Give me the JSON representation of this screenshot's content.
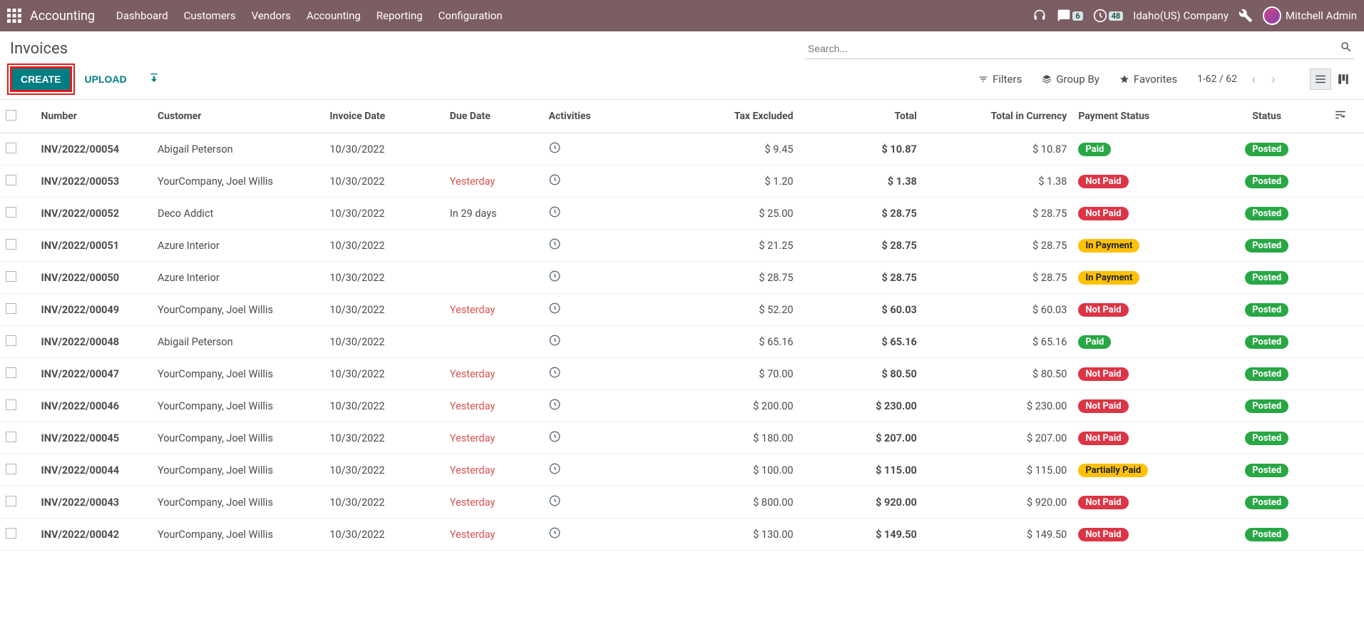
{
  "topbar": {
    "app_title": "Accounting",
    "nav": [
      "Dashboard",
      "Customers",
      "Vendors",
      "Accounting",
      "Reporting",
      "Configuration"
    ],
    "chat_badge": "6",
    "activity_badge": "48",
    "company": "Idaho(US) Company",
    "user": "Mitchell Admin"
  },
  "page": {
    "title": "Invoices",
    "create": "CREATE",
    "upload": "UPLOAD",
    "search_placeholder": "Search...",
    "filters": "Filters",
    "group_by": "Group By",
    "favorites": "Favorites",
    "pager": "1-62 / 62"
  },
  "columns": {
    "number": "Number",
    "customer": "Customer",
    "invoice_date": "Invoice Date",
    "due_date": "Due Date",
    "activities": "Activities",
    "tax_excluded": "Tax Excluded",
    "total": "Total",
    "total_currency": "Total in Currency",
    "payment_status": "Payment Status",
    "status": "Status"
  },
  "rows": [
    {
      "number": "INV/2022/00054",
      "customer": "Abigail Peterson",
      "invoice_date": "10/30/2022",
      "due_date": "",
      "due_red": false,
      "tax": "$ 9.45",
      "total": "$ 10.87",
      "currency": "$ 10.87",
      "pay": "Paid",
      "pay_cls": "pay-paid",
      "status": "Posted"
    },
    {
      "number": "INV/2022/00053",
      "customer": "YourCompany, Joel Willis",
      "invoice_date": "10/30/2022",
      "due_date": "Yesterday",
      "due_red": true,
      "tax": "$ 1.20",
      "total": "$ 1.38",
      "currency": "$ 1.38",
      "pay": "Not Paid",
      "pay_cls": "pay-notpaid",
      "status": "Posted"
    },
    {
      "number": "INV/2022/00052",
      "customer": "Deco Addict",
      "invoice_date": "10/30/2022",
      "due_date": "In 29 days",
      "due_red": false,
      "tax": "$ 25.00",
      "total": "$ 28.75",
      "currency": "$ 28.75",
      "pay": "Not Paid",
      "pay_cls": "pay-notpaid",
      "status": "Posted"
    },
    {
      "number": "INV/2022/00051",
      "customer": "Azure Interior",
      "invoice_date": "10/30/2022",
      "due_date": "",
      "due_red": false,
      "tax": "$ 21.25",
      "total": "$ 28.75",
      "currency": "$ 28.75",
      "pay": "In Payment",
      "pay_cls": "pay-inpayment",
      "status": "Posted"
    },
    {
      "number": "INV/2022/00050",
      "customer": "Azure Interior",
      "invoice_date": "10/30/2022",
      "due_date": "",
      "due_red": false,
      "tax": "$ 28.75",
      "total": "$ 28.75",
      "currency": "$ 28.75",
      "pay": "In Payment",
      "pay_cls": "pay-inpayment",
      "status": "Posted"
    },
    {
      "number": "INV/2022/00049",
      "customer": "YourCompany, Joel Willis",
      "invoice_date": "10/30/2022",
      "due_date": "Yesterday",
      "due_red": true,
      "tax": "$ 52.20",
      "total": "$ 60.03",
      "currency": "$ 60.03",
      "pay": "Not Paid",
      "pay_cls": "pay-notpaid",
      "status": "Posted"
    },
    {
      "number": "INV/2022/00048",
      "customer": "Abigail Peterson",
      "invoice_date": "10/30/2022",
      "due_date": "",
      "due_red": false,
      "tax": "$ 65.16",
      "total": "$ 65.16",
      "currency": "$ 65.16",
      "pay": "Paid",
      "pay_cls": "pay-paid",
      "status": "Posted"
    },
    {
      "number": "INV/2022/00047",
      "customer": "YourCompany, Joel Willis",
      "invoice_date": "10/30/2022",
      "due_date": "Yesterday",
      "due_red": true,
      "tax": "$ 70.00",
      "total": "$ 80.50",
      "currency": "$ 80.50",
      "pay": "Not Paid",
      "pay_cls": "pay-notpaid",
      "status": "Posted"
    },
    {
      "number": "INV/2022/00046",
      "customer": "YourCompany, Joel Willis",
      "invoice_date": "10/30/2022",
      "due_date": "Yesterday",
      "due_red": true,
      "tax": "$ 200.00",
      "total": "$ 230.00",
      "currency": "$ 230.00",
      "pay": "Not Paid",
      "pay_cls": "pay-notpaid",
      "status": "Posted"
    },
    {
      "number": "INV/2022/00045",
      "customer": "YourCompany, Joel Willis",
      "invoice_date": "10/30/2022",
      "due_date": "Yesterday",
      "due_red": true,
      "tax": "$ 180.00",
      "total": "$ 207.00",
      "currency": "$ 207.00",
      "pay": "Not Paid",
      "pay_cls": "pay-notpaid",
      "status": "Posted"
    },
    {
      "number": "INV/2022/00044",
      "customer": "YourCompany, Joel Willis",
      "invoice_date": "10/30/2022",
      "due_date": "Yesterday",
      "due_red": true,
      "tax": "$ 100.00",
      "total": "$ 115.00",
      "currency": "$ 115.00",
      "pay": "Partially Paid",
      "pay_cls": "pay-partial",
      "status": "Posted"
    },
    {
      "number": "INV/2022/00043",
      "customer": "YourCompany, Joel Willis",
      "invoice_date": "10/30/2022",
      "due_date": "Yesterday",
      "due_red": true,
      "tax": "$ 800.00",
      "total": "$ 920.00",
      "currency": "$ 920.00",
      "pay": "Not Paid",
      "pay_cls": "pay-notpaid",
      "status": "Posted"
    },
    {
      "number": "INV/2022/00042",
      "customer": "YourCompany, Joel Willis",
      "invoice_date": "10/30/2022",
      "due_date": "Yesterday",
      "due_red": true,
      "tax": "$ 130.00",
      "total": "$ 149.50",
      "currency": "$ 149.50",
      "pay": "Not Paid",
      "pay_cls": "pay-notpaid",
      "status": "Posted"
    }
  ]
}
